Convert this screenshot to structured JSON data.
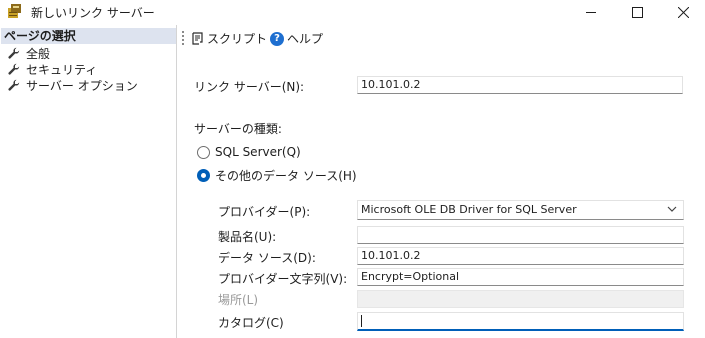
{
  "window": {
    "title": "新しいリンク サーバー"
  },
  "left_pane": {
    "header": "ページの選択",
    "items": [
      {
        "label": "全般"
      },
      {
        "label": "セキュリティ"
      },
      {
        "label": "サーバー オプション"
      }
    ]
  },
  "toolbar": {
    "script_label": "スクリプト",
    "help_label": "ヘルプ"
  },
  "form": {
    "linked_server_label": "リンク サーバー(N):",
    "linked_server_value": "10.101.0.2",
    "server_type_label": "サーバーの種類:",
    "radio_sql_server_label": "SQL Server(Q)",
    "radio_sql_server_selected": false,
    "radio_other_label": "その他のデータ ソース(H)",
    "radio_other_selected": true,
    "provider_label": "プロバイダー(P):",
    "provider_value": "Microsoft OLE DB Driver for SQL Server",
    "product_name_label": "製品名(U):",
    "product_name_value": "",
    "data_source_label": "データ ソース(D):",
    "data_source_value": "10.101.0.2",
    "provider_string_label": "プロバイダー文字列(V):",
    "provider_string_value": "Encrypt=Optional",
    "location_label": "場所(L)",
    "location_value": "",
    "catalog_label": "カタログ(C)",
    "catalog_value": ""
  },
  "colors": {
    "accent": "#005fb8",
    "help_icon": "#1e6fd0",
    "selected_page_bg": "#dde3ef"
  }
}
